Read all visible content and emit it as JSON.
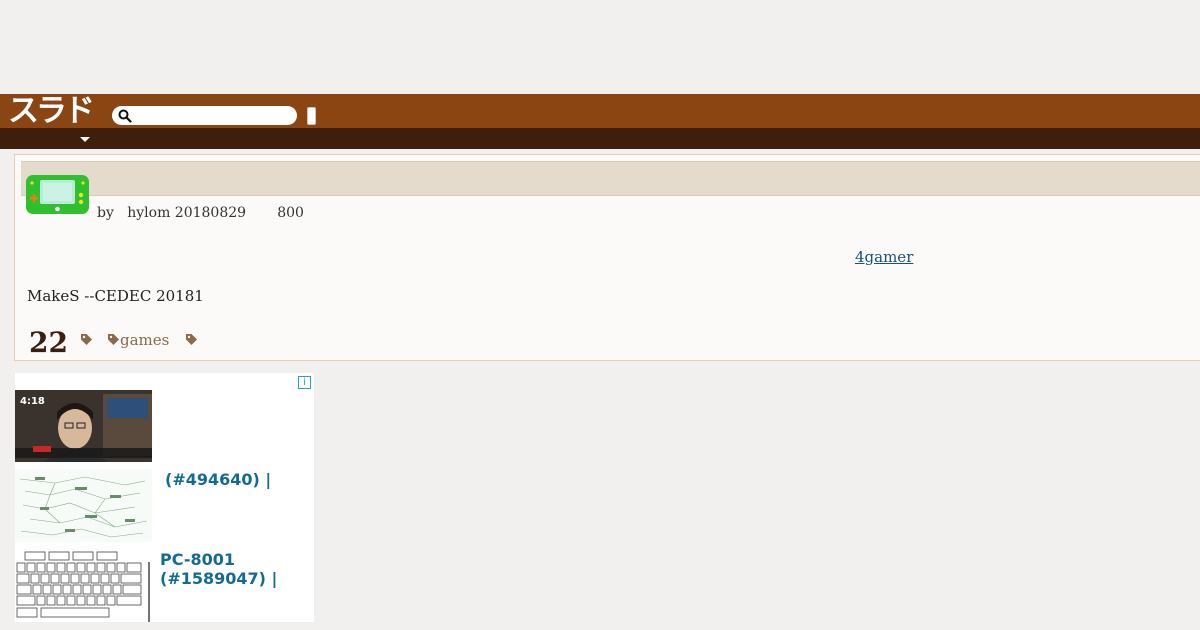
{
  "header": {
    "logo_text": "スラド",
    "search": {
      "placeholder": ""
    },
    "colors": {
      "header_bg": "#8b4513",
      "subnav_bg": "#3d1f0c"
    }
  },
  "article": {
    "byline_by": "by",
    "byline_author": "hylom",
    "byline_date": "20180829",
    "byline_count": "800",
    "source_link": "4gamer",
    "body": "MakeS --CEDEC 20181",
    "comment_count": "22",
    "tags": [
      "",
      "games",
      ""
    ],
    "topic_icon": "handheld-game-icon"
  },
  "ad": {
    "info_glyph": "i",
    "items": [
      {
        "title": "",
        "thumb": "video-thumbnail"
      },
      {
        "title": "(#494640) |",
        "thumb": "diagram-thumbnail"
      },
      {
        "title": "PC-8001\n(#1589047) |",
        "thumb": "keyboard-thumbnail"
      }
    ],
    "thumb1_time": "4:18"
  }
}
